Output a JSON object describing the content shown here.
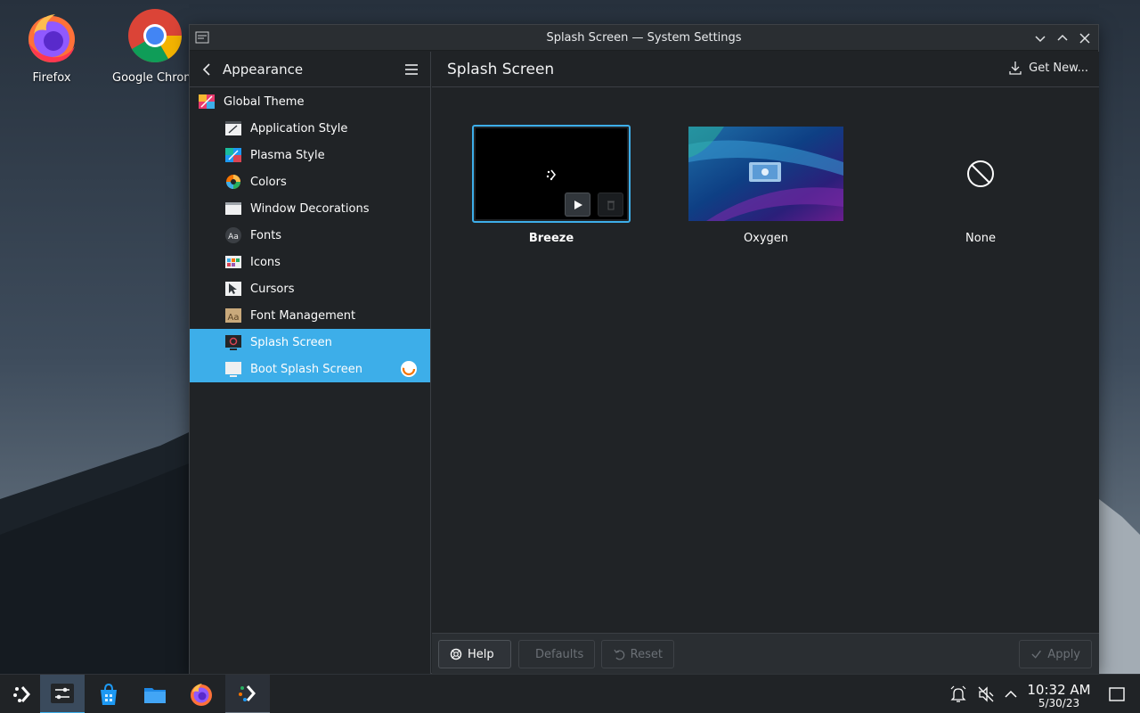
{
  "desktop": {
    "icons": [
      {
        "label": "Firefox",
        "icon": "firefox-icon"
      },
      {
        "label": "Google Chrome",
        "icon": "chrome-icon"
      }
    ]
  },
  "window": {
    "title": "Splash Screen — System Settings",
    "controls": [
      "minimize",
      "maximize",
      "close"
    ]
  },
  "sidebar": {
    "heading": "Appearance",
    "items": [
      {
        "label": "Global Theme",
        "icon": "global-theme-icon",
        "level": "top"
      },
      {
        "label": "Application Style",
        "icon": "application-style-icon",
        "level": "sub"
      },
      {
        "label": "Plasma Style",
        "icon": "plasma-style-icon",
        "level": "sub"
      },
      {
        "label": "Colors",
        "icon": "colors-icon",
        "level": "sub"
      },
      {
        "label": "Window Decorations",
        "icon": "window-decorations-icon",
        "level": "sub"
      },
      {
        "label": "Fonts",
        "icon": "fonts-icon",
        "level": "sub"
      },
      {
        "label": "Icons",
        "icon": "icons-icon",
        "level": "sub"
      },
      {
        "label": "Cursors",
        "icon": "cursors-icon",
        "level": "sub"
      },
      {
        "label": "Font Management",
        "icon": "font-management-icon",
        "level": "sub"
      },
      {
        "label": "Splash Screen",
        "icon": "splash-screen-icon",
        "level": "sub",
        "state": "selected"
      },
      {
        "label": "Boot Splash Screen",
        "icon": "boot-splash-icon",
        "level": "sub",
        "state": "hover"
      }
    ]
  },
  "content": {
    "heading": "Splash Screen",
    "get_new": "Get New...",
    "themes": [
      {
        "label": "Breeze",
        "selected": true
      },
      {
        "label": "Oxygen",
        "selected": false
      },
      {
        "label": "None",
        "selected": false
      }
    ]
  },
  "footer": {
    "help": "Help",
    "defaults": "Defaults",
    "reset": "Reset",
    "apply": "Apply"
  },
  "taskbar": {
    "time": "10:32 AM",
    "date": "5/30/23",
    "apps": [
      "app-launcher-icon",
      "system-settings-icon",
      "discover-icon",
      "dolphin-icon",
      "firefox-icon",
      "steam-deck-icon"
    ]
  },
  "colors": {
    "accent": "#3daee9",
    "window_bg": "#202326",
    "taskbar_bg": "#202326"
  }
}
